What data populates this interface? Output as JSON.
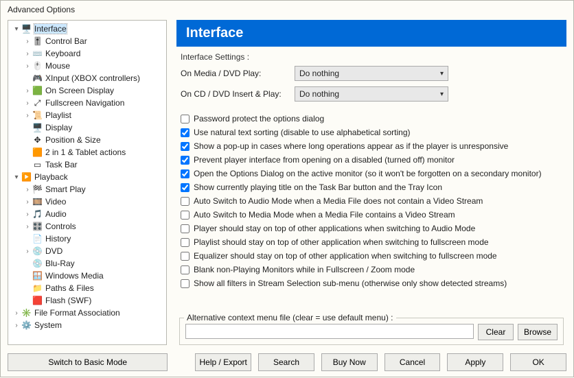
{
  "window": {
    "title": "Advanced Options"
  },
  "tree": [
    {
      "depth": 0,
      "expander": "▾",
      "icon": "🖥️",
      "label": "Interface",
      "selected": true
    },
    {
      "depth": 1,
      "expander": "›",
      "icon": "🎚️",
      "label": "Control Bar"
    },
    {
      "depth": 1,
      "expander": "›",
      "icon": "⌨️",
      "label": "Keyboard"
    },
    {
      "depth": 1,
      "expander": "›",
      "icon": "🖱️",
      "label": "Mouse"
    },
    {
      "depth": 1,
      "expander": "",
      "icon": "🎮",
      "label": "XInput (XBOX controllers)"
    },
    {
      "depth": 1,
      "expander": "›",
      "icon": "🟩",
      "label": "On Screen Display"
    },
    {
      "depth": 1,
      "expander": "›",
      "icon": "⤢",
      "label": "Fullscreen Navigation"
    },
    {
      "depth": 1,
      "expander": "›",
      "icon": "📜",
      "label": "Playlist"
    },
    {
      "depth": 1,
      "expander": "",
      "icon": "🖥️",
      "label": "Display"
    },
    {
      "depth": 1,
      "expander": "",
      "icon": "✥",
      "label": "Position & Size"
    },
    {
      "depth": 1,
      "expander": "",
      "icon": "🟧",
      "label": "2 in 1 & Tablet actions"
    },
    {
      "depth": 1,
      "expander": "",
      "icon": "▭",
      "label": "Task Bar"
    },
    {
      "depth": 0,
      "expander": "▾",
      "icon": "▶️",
      "label": "Playback"
    },
    {
      "depth": 1,
      "expander": "›",
      "icon": "🏁",
      "label": "Smart Play"
    },
    {
      "depth": 1,
      "expander": "›",
      "icon": "🎞️",
      "label": "Video"
    },
    {
      "depth": 1,
      "expander": "›",
      "icon": "🎵",
      "label": "Audio"
    },
    {
      "depth": 1,
      "expander": "›",
      "icon": "🎛️",
      "label": "Controls"
    },
    {
      "depth": 1,
      "expander": "",
      "icon": "📄",
      "label": "History"
    },
    {
      "depth": 1,
      "expander": "›",
      "icon": "💿",
      "label": "DVD"
    },
    {
      "depth": 1,
      "expander": "",
      "icon": "💿",
      "label": "Blu-Ray"
    },
    {
      "depth": 1,
      "expander": "",
      "icon": "🪟",
      "label": "Windows Media"
    },
    {
      "depth": 1,
      "expander": "",
      "icon": "📁",
      "label": "Paths & Files"
    },
    {
      "depth": 1,
      "expander": "",
      "icon": "🟥",
      "label": "Flash (SWF)"
    },
    {
      "depth": 0,
      "expander": "›",
      "icon": "✳️",
      "label": "File Format Association"
    },
    {
      "depth": 0,
      "expander": "›",
      "icon": "⚙️",
      "label": "System"
    }
  ],
  "header": {
    "title": "Interface"
  },
  "subtitle": "Interface Settings :",
  "combos": [
    {
      "label": "On Media / DVD Play:",
      "value": "Do nothing"
    },
    {
      "label": "On CD / DVD Insert & Play:",
      "value": "Do nothing"
    }
  ],
  "checkboxes": [
    {
      "c": false,
      "t": "Password protect the options dialog"
    },
    {
      "c": true,
      "t": "Use natural text sorting (disable to use alphabetical sorting)"
    },
    {
      "c": true,
      "t": "Show a pop-up in cases where long operations appear as if the player is unresponsive"
    },
    {
      "c": true,
      "t": "Prevent player interface from opening on a disabled (turned off) monitor"
    },
    {
      "c": true,
      "t": "Open the Options Dialog on the active monitor (so it won't be forgotten on a secondary monitor)"
    },
    {
      "c": true,
      "t": "Show currently playing title on the Task Bar button and the Tray Icon"
    },
    {
      "c": false,
      "t": "Auto Switch to Audio Mode when a Media File does not contain a Video Stream"
    },
    {
      "c": false,
      "t": "Auto Switch to Media Mode when a Media File contains a Video Stream"
    },
    {
      "c": false,
      "t": "Player should stay on top of other applications when switching to Audio Mode"
    },
    {
      "c": false,
      "t": "Playlist should stay on top of other application when switching to fullscreen mode"
    },
    {
      "c": false,
      "t": "Equalizer should stay on top of other application when switching to fullscreen mode"
    },
    {
      "c": false,
      "t": "Blank non-Playing Monitors while in Fullscreen / Zoom mode"
    },
    {
      "c": false,
      "t": "Show all filters in Stream Selection sub-menu (otherwise only show detected streams)"
    }
  ],
  "alt_menu": {
    "legend": "Alternative context menu file (clear = use default menu) :",
    "value": "",
    "clear": "Clear",
    "browse": "Browse"
  },
  "bottom": {
    "switch": "Switch to Basic Mode",
    "help": "Help / Export",
    "search": "Search",
    "buy": "Buy Now",
    "cancel": "Cancel",
    "apply": "Apply",
    "ok": "OK"
  }
}
